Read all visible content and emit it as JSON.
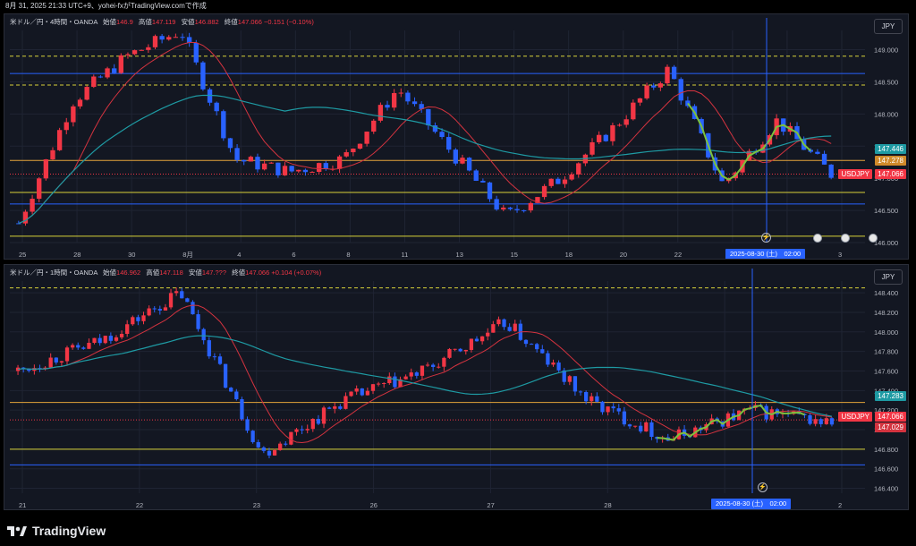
{
  "header_text": "8月 31, 2025 21:33 UTC+9、yohei-fxがTradingView.comで作成",
  "brand": "TradingView",
  "colors": {
    "up": "#f23645",
    "down": "#2962ff",
    "ma_fast": "#d3333f",
    "ma_slow": "#1e9aa3",
    "wave": "#7cc23d",
    "hline_blue": "#2962ff",
    "hline_orange": "#e3a33a",
    "hline_yellow": "#d8d23a",
    "hline_dashed": "#d8d23a",
    "bg": "#131722",
    "grid": "#1f2433"
  },
  "panes": [
    {
      "id": "p1",
      "legend_title": "米ドル／円・4時間・OANDA",
      "legend_fields": [
        {
          "label": "始値",
          "value": "146.9"
        },
        {
          "label": "高値",
          "value": "147.119"
        },
        {
          "label": "安値",
          "value": "146.882"
        },
        {
          "label": "終値",
          "value": "147.066"
        }
      ],
      "legend_change": "−0.151 (−0.10%)",
      "currency": "JPY",
      "y_ticks": [
        "149.000",
        "148.500",
        "148.000",
        "147.500",
        "147.000",
        "146.500",
        "146.000"
      ],
      "x_ticks": [
        "25",
        "28",
        "30",
        "8月",
        "4",
        "6",
        "8",
        "11",
        "13",
        "15",
        "18",
        "20",
        "22",
        "25",
        "27",
        "3"
      ],
      "price_tags": [
        {
          "value": "147.446",
          "color": "#1e9aa3"
        },
        {
          "value": "147.278",
          "color": "#d08a2a"
        },
        {
          "label": "USDJPY",
          "value": "147.066",
          "color": "#f23645"
        }
      ],
      "date_label": "2025-08-30 (土)　02:00",
      "chart_data": {
        "type": "candlestick",
        "title": "米ドル／円・4時間・OANDA",
        "ylim": [
          146.0,
          149.3
        ],
        "grid": true,
        "horizontal_levels": [
          {
            "price": 148.9,
            "style": "dashed",
            "color": "yellow"
          },
          {
            "price": 148.45,
            "style": "dashed",
            "color": "yellow"
          },
          {
            "price": 148.63,
            "style": "solid",
            "color": "blue"
          },
          {
            "price": 147.278,
            "style": "solid",
            "color": "orange"
          },
          {
            "price": 147.066,
            "style": "dotted",
            "color": "red"
          },
          {
            "price": 146.78,
            "style": "solid",
            "color": "yellow"
          },
          {
            "price": 146.6,
            "style": "solid",
            "color": "blue"
          },
          {
            "price": 146.1,
            "style": "solid",
            "color": "yellow"
          }
        ],
        "key_points": [
          {
            "x": "25",
            "price": 146.3
          },
          {
            "x": "28",
            "price": 148.2
          },
          {
            "x": "30",
            "price": 148.9
          },
          {
            "x": "8月",
            "price": 149.3
          },
          {
            "x": "4",
            "price": 147.3
          },
          {
            "x": "6",
            "price": 147.1
          },
          {
            "x": "8",
            "price": 147.3
          },
          {
            "x": "11",
            "price": 148.4
          },
          {
            "x": "13",
            "price": 147.4
          },
          {
            "x": "15",
            "price": 146.4
          },
          {
            "x": "18",
            "price": 147.0
          },
          {
            "x": "20",
            "price": 147.8
          },
          {
            "x": "22",
            "price": 148.7
          },
          {
            "x": "25",
            "price": 146.9
          },
          {
            "x": "27",
            "price": 147.9
          },
          {
            "x": "3",
            "price": 147.066
          }
        ],
        "last_price": 147.066
      }
    },
    {
      "id": "p2",
      "legend_title": "米ドル／円・1時間・OANDA",
      "legend_fields": [
        {
          "label": "始値",
          "value": "146.962"
        },
        {
          "label": "高値",
          "value": "147.118"
        },
        {
          "label": "安値",
          "value": "147.???"
        },
        {
          "label": "終値",
          "value": "147.066"
        }
      ],
      "legend_change": "+0.104 (+0.07%)",
      "currency": "JPY",
      "y_ticks": [
        "148.400",
        "148.200",
        "148.000",
        "147.800",
        "147.600",
        "147.400",
        "147.200",
        "147.000",
        "146.800",
        "146.600",
        "146.400"
      ],
      "x_ticks": [
        "21",
        "22",
        "23",
        "26",
        "27",
        "28",
        "29",
        "2"
      ],
      "price_tags": [
        {
          "value": "147.283",
          "color": "#1e9aa3"
        },
        {
          "label": "USDJPY",
          "value": "147.066",
          "color": "#f23645"
        },
        {
          "value": "147.029",
          "color": "#d3333f"
        }
      ],
      "date_label": "2025-08-30 (土)　02:00",
      "chart_data": {
        "type": "candlestick",
        "title": "米ドル／円・1時間・OANDA",
        "ylim": [
          146.35,
          148.52
        ],
        "grid": true,
        "horizontal_levels": [
          {
            "price": 148.45,
            "style": "dashed",
            "color": "yellow"
          },
          {
            "price": 147.278,
            "style": "solid",
            "color": "orange"
          },
          {
            "price": 147.1,
            "style": "dotted",
            "color": "red"
          },
          {
            "price": 146.8,
            "style": "solid",
            "color": "yellow"
          },
          {
            "price": 146.64,
            "style": "solid",
            "color": "blue"
          }
        ],
        "key_points": [
          {
            "x": "21",
            "price": 147.6
          },
          {
            "x": "22",
            "price": 147.9
          },
          {
            "x": "22b",
            "price": 148.4
          },
          {
            "x": "23",
            "price": 146.75
          },
          {
            "x": "26",
            "price": 147.3
          },
          {
            "x": "27",
            "price": 147.6
          },
          {
            "x": "28",
            "price": 148.1
          },
          {
            "x": "28b",
            "price": 147.3
          },
          {
            "x": "29",
            "price": 146.9
          },
          {
            "x": "29b",
            "price": 147.2
          },
          {
            "x": "2",
            "price": 147.066
          }
        ],
        "last_price": 147.066
      }
    }
  ]
}
